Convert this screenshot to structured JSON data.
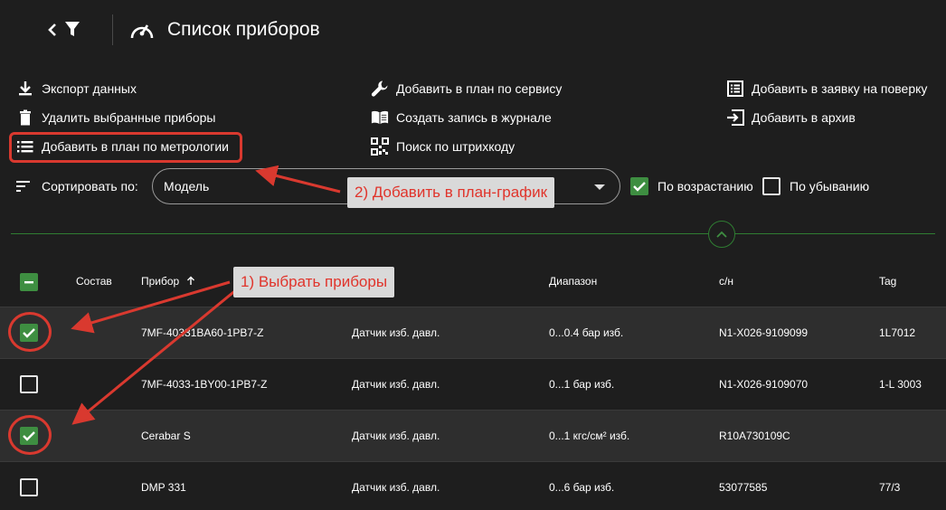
{
  "header": {
    "title": "Список приборов",
    "back_icon": "chevron-left-icon",
    "filter_icon": "filter-icon",
    "page_icon": "gauge-icon"
  },
  "actions": [
    {
      "id": "export",
      "label": "Экспорт данных",
      "icon": "download-icon"
    },
    {
      "id": "delete",
      "label": "Удалить выбранные приборы",
      "icon": "trash-icon"
    },
    {
      "id": "metrology",
      "label": "Добавить в план по метрологии",
      "icon": "list-icon"
    },
    {
      "id": "service",
      "label": "Добавить в план по сервису",
      "icon": "wrench-icon"
    },
    {
      "id": "journal",
      "label": "Создать запись в журнале",
      "icon": "book-icon"
    },
    {
      "id": "barcode",
      "label": "Поиск по штрихкоду",
      "icon": "qr-icon"
    },
    {
      "id": "verify",
      "label": "Добавить в заявку на поверку",
      "icon": "checklist-icon"
    },
    {
      "id": "archive",
      "label": "Добавить в архив",
      "icon": "archive-icon"
    }
  ],
  "sort": {
    "label": "Сортировать по:",
    "selected": "Модель",
    "ascending_label": "По возрастанию",
    "ascending_checked": true,
    "descending_label": "По убыванию",
    "descending_checked": false
  },
  "table": {
    "columns": {
      "composition": "Состав",
      "device": "Прибор",
      "range": "Диапазон",
      "serial": "с/н",
      "tag": "Tag"
    },
    "rows": [
      {
        "selected": true,
        "device": "7MF-40331BA60-1PB7-Z",
        "type": "Датчик изб. давл.",
        "range": "0...0.4 бар изб.",
        "serial": "N1-X026-9109099",
        "tag": "1L7012"
      },
      {
        "selected": false,
        "device": "7MF-4033-1BY00-1PB7-Z",
        "type": "Датчик изб. давл.",
        "range": "0...1 бар изб.",
        "serial": "N1-X026-9109070",
        "tag": "1-L 3003"
      },
      {
        "selected": true,
        "device": "Cerabar S",
        "type": "Датчик изб. давл.",
        "range": "0...1 кгс/см² изб.",
        "serial": "R10A730109C",
        "tag": ""
      },
      {
        "selected": false,
        "device": "DMP 331",
        "type": "Датчик изб. давл.",
        "range": "0...6 бар изб.",
        "serial": "53077585",
        "tag": "77/3"
      }
    ]
  },
  "callouts": {
    "step1": "1) Выбрать приборы",
    "step2": "2) Добавить в план-график"
  },
  "colors": {
    "background": "#1e1e1e",
    "accent_green": "#3e8e41",
    "annotation_red": "#d9392f"
  }
}
